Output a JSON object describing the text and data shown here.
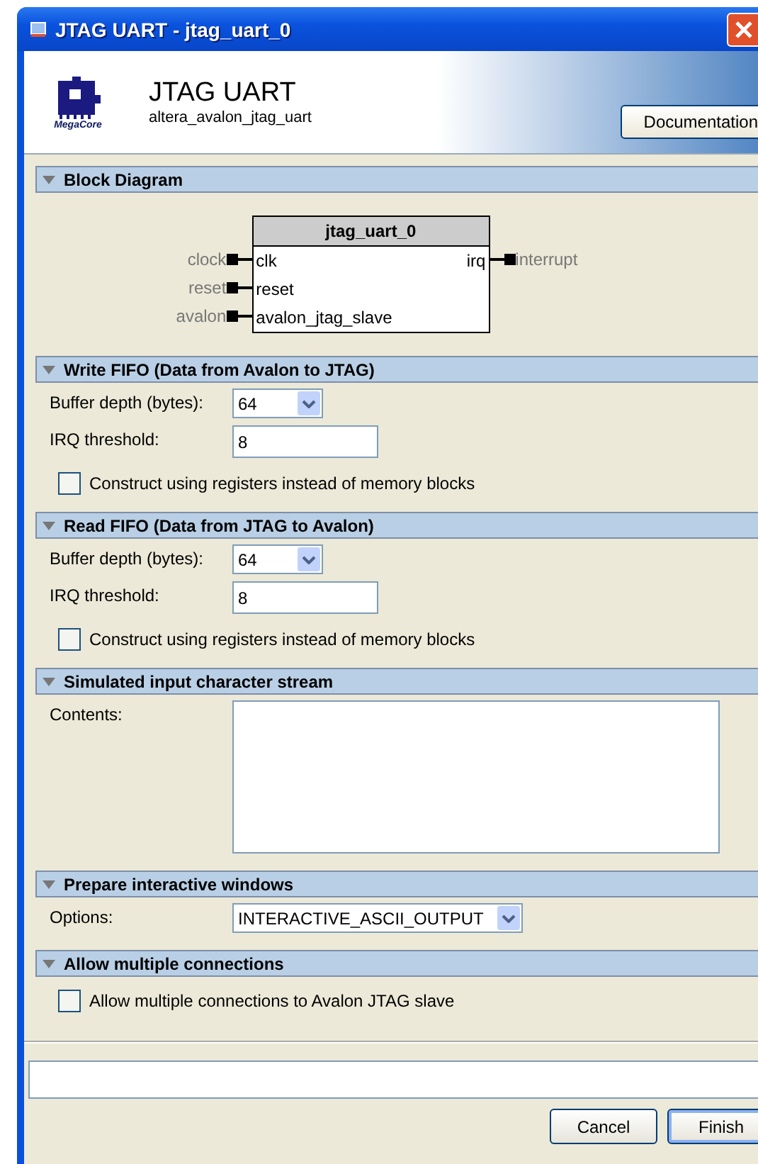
{
  "window": {
    "title": "JTAG UART - jtag_uart_0"
  },
  "header": {
    "logo_text": "MegaCore",
    "title": "JTAG UART",
    "subtitle": "altera_avalon_jtag_uart",
    "button": "Documentation"
  },
  "sections": [
    {
      "kind": "diagram",
      "title": "Block Diagram",
      "expanded": true,
      "module": "jtag_uart_0",
      "left_ports": [
        {
          "signal": "clock",
          "port": "clk"
        },
        {
          "signal": "reset",
          "port": "reset"
        },
        {
          "signal": "avalon",
          "port": "avalon_jtag_slave"
        }
      ],
      "right_ports": [
        {
          "port": "irq",
          "signal": "interrupt"
        }
      ]
    },
    {
      "kind": "form",
      "title": "Write FIFO (Data from Avalon to JTAG)",
      "expanded": true,
      "rows": [
        {
          "kind": "dropdown",
          "label": "Buffer depth (bytes):",
          "value": "64"
        },
        {
          "kind": "text",
          "label": "IRQ threshold:",
          "value": "8"
        },
        {
          "kind": "checkbox",
          "label": "Construct using registers instead of memory blocks",
          "checked": false
        }
      ]
    },
    {
      "kind": "form",
      "title": "Read FIFO (Data from JTAG to Avalon)",
      "expanded": true,
      "rows": [
        {
          "kind": "dropdown",
          "label": "Buffer depth (bytes):",
          "value": "64"
        },
        {
          "kind": "text",
          "label": "IRQ threshold:",
          "value": "8"
        },
        {
          "kind": "checkbox",
          "label": "Construct using registers instead of memory blocks",
          "checked": false
        }
      ]
    },
    {
      "kind": "form",
      "title": "Simulated input character stream",
      "expanded": true,
      "rows": [
        {
          "kind": "textarea",
          "label": "Contents:"
        }
      ]
    },
    {
      "kind": "form",
      "title": "Prepare interactive windows",
      "expanded": true,
      "rows": [
        {
          "kind": "wide-dropdown",
          "label": "Options:",
          "value": "INTERACTIVE_ASCII_OUTPUT"
        }
      ]
    },
    {
      "kind": "form",
      "title": "Allow multiple connections",
      "expanded": true,
      "rows": [
        {
          "kind": "checkbox",
          "label": "Allow multiple connections to Avalon JTAG slave",
          "checked": false
        }
      ]
    }
  ],
  "buttons": [
    {
      "label": "Cancel",
      "default": false
    },
    {
      "label": "Finish",
      "default": true
    }
  ]
}
